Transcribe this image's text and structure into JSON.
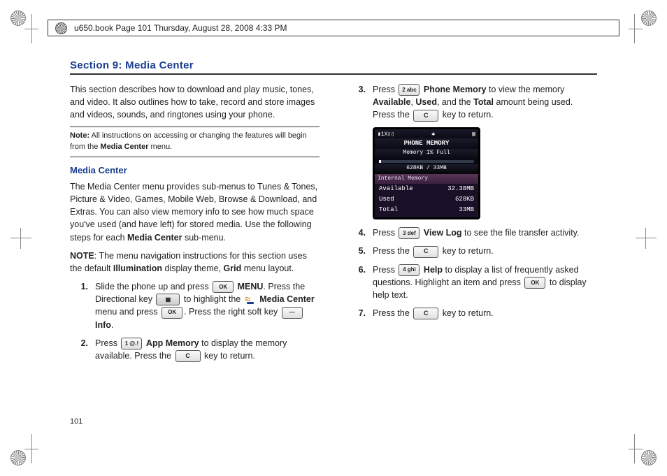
{
  "header": {
    "framemaker": "u650.book  Page 101  Thursday, August 28, 2008  4:33 PM"
  },
  "section_title": "Section 9: Media Center",
  "page_number": "101",
  "left": {
    "intro": "This section describes how to download and play music, tones, and video. It also outlines how to take, record and store images and videos, sounds, and ringtones using your phone.",
    "note_label": "Note:",
    "note_text": " All instructions on accessing or changing the features will begin from the ",
    "note_bold": "Media Center",
    "note_tail": " menu.",
    "subhead": "Media Center",
    "para1a": "The Media Center menu provides sub-menus to Tunes & Tones, Picture & Video, Games, Mobile Web, Browse & Download, and Extras. You can also view memory info to see how much space you've used (and have left) for stored media. Use the following steps for each ",
    "para1b": "Media Center",
    "para1c": " sub-menu.",
    "para2a": "NOTE",
    "para2b": ": The menu navigation instructions for this section uses the default ",
    "para2c": "Illumination",
    "para2d": " display theme, ",
    "para2e": "Grid",
    "para2f": " menu layout.",
    "steps": [
      {
        "num": "1.",
        "a": "Slide the phone up and press ",
        "key1": "OK",
        "b": " ",
        "bold1": "MENU",
        "c": ". Press the Directional key ",
        "key2": "▦",
        "d": " to highlight the ",
        "bold2": "Media Center",
        "e": " menu and press ",
        "key3": "OK",
        "f": ".  Press the right soft key ",
        "key4": "—",
        "g": " ",
        "bold3": "Info",
        "h": "."
      },
      {
        "num": "2.",
        "a": "Press ",
        "key1": "1 @.!",
        "bold1": "App Memory",
        "b": " to display the memory available. Press the ",
        "key2": "C",
        "c": " key to return."
      }
    ]
  },
  "right": {
    "step3": {
      "num": "3.",
      "a": "Press ",
      "key1": "2 abc",
      "bold1": "Phone Memory",
      "b": " to view the memory ",
      "bold2": "Available",
      "c": ", ",
      "bold3": "Used",
      "d": ", and the ",
      "bold4": "Total",
      "e": " amount being used. Press the ",
      "key2": "C",
      "f": " key to return."
    },
    "phone": {
      "status_left": "▮1X▯▯",
      "status_mid": "✱",
      "status_right": "▥",
      "title": "PHONE MEMORY",
      "sub": "Memory 1% Full",
      "barlabel": "628KB / 33MB",
      "section": "Internal Memory",
      "row1k": "Available",
      "row1v": "32.38MB",
      "row2k": "Used",
      "row2v": "628KB",
      "row3k": "Total",
      "row3v": "33MB"
    },
    "step4": {
      "num": "4.",
      "a": "Press ",
      "key1": "3 def",
      "bold1": "View Log",
      "b": " to see the file transfer activity."
    },
    "step5": {
      "num": "5.",
      "a": "Press the ",
      "key1": "C",
      "b": " key to return."
    },
    "step6": {
      "num": "6.",
      "a": "Press ",
      "key1": "4 ghi",
      "bold1": "Help",
      "b": " to display a list of frequently asked questions. Highlight an item and press ",
      "key2": "OK",
      "c": " to display help text."
    },
    "step7": {
      "num": "7.",
      "a": "Press the ",
      "key1": "C",
      "b": " key to return."
    }
  }
}
